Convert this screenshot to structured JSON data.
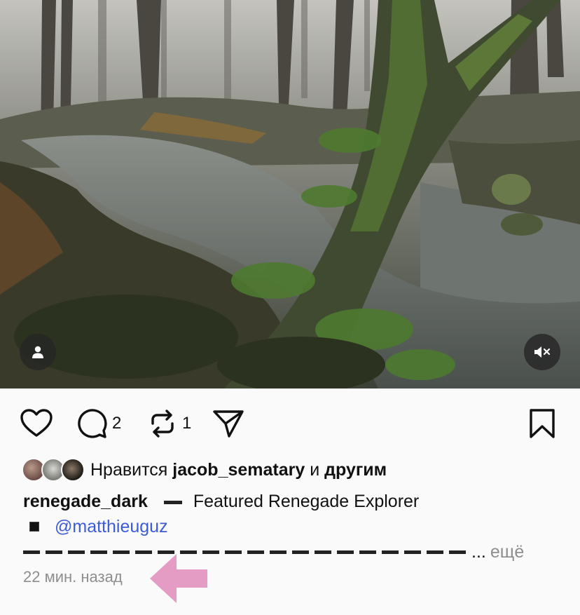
{
  "post": {
    "media": {
      "user_tag_icon": "person-icon",
      "mute_icon": "speaker-muted-icon"
    },
    "actions": {
      "like_icon": "heart-icon",
      "comment_icon": "comment-bubble-icon",
      "comment_count": "2",
      "repost_icon": "repost-icon",
      "repost_count": "1",
      "share_icon": "paper-plane-icon",
      "save_icon": "bookmark-icon"
    },
    "likes": {
      "prefix": "Нравится",
      "user": "jacob_sematary",
      "conjunction": "и",
      "others": "другим"
    },
    "caption": {
      "username": "renegade_dark",
      "text": "Featured Renegade Explorer",
      "mention": "@matthieuguz",
      "ellipsis": "...",
      "more_label": "ещё"
    },
    "timestamp": "22 мин. назад"
  },
  "colors": {
    "mention": "#3c5bd8",
    "muted_text": "#8e8e8e",
    "annotation_arrow": "#e59cc4"
  }
}
